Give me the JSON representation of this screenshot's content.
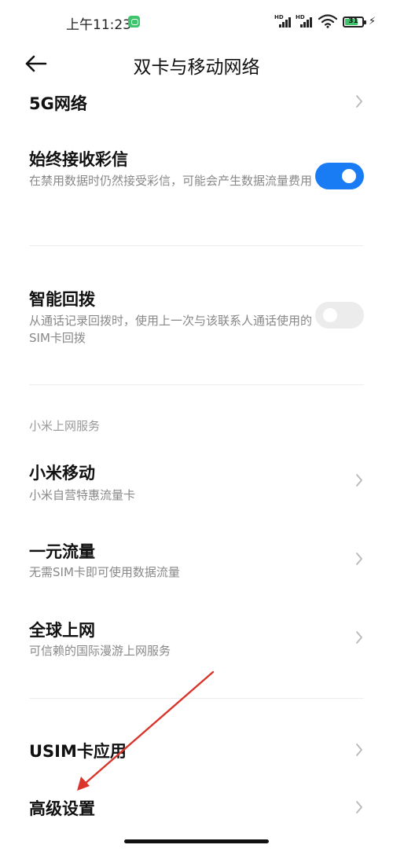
{
  "status_bar": {
    "time": "上午11:23",
    "network_1": "HD",
    "network_2": "HD",
    "battery": "31"
  },
  "header": {
    "title": "双卡与移动网络"
  },
  "settings": {
    "network_5g": {
      "title": "5G网络"
    },
    "mms": {
      "title": "始终接收彩信",
      "subtitle": "在禁用数据时仍然接受彩信，可能会产生数据流量费用",
      "enabled": true
    },
    "smart_callback": {
      "title": "智能回拨",
      "subtitle": "从通话记录回拨时，使用上一次与该联系人通话使用的SIM卡回拨",
      "enabled": false
    }
  },
  "internet_services": {
    "header": "小米上网服务",
    "items": [
      {
        "title": "小米移动",
        "subtitle": "小米自营特惠流量卡"
      },
      {
        "title": "一元流量",
        "subtitle": "无需SIM卡即可使用数据流量"
      },
      {
        "title": "全球上网",
        "subtitle": "可信赖的国际漫游上网服务"
      }
    ]
  },
  "bottom": {
    "usim": {
      "title": "USIM卡应用"
    },
    "advanced": {
      "title": "高级设置"
    }
  },
  "colors": {
    "toggle_on": "#1a7cf5",
    "toggle_off": "#ececec",
    "annotation_arrow": "#d9352b"
  }
}
